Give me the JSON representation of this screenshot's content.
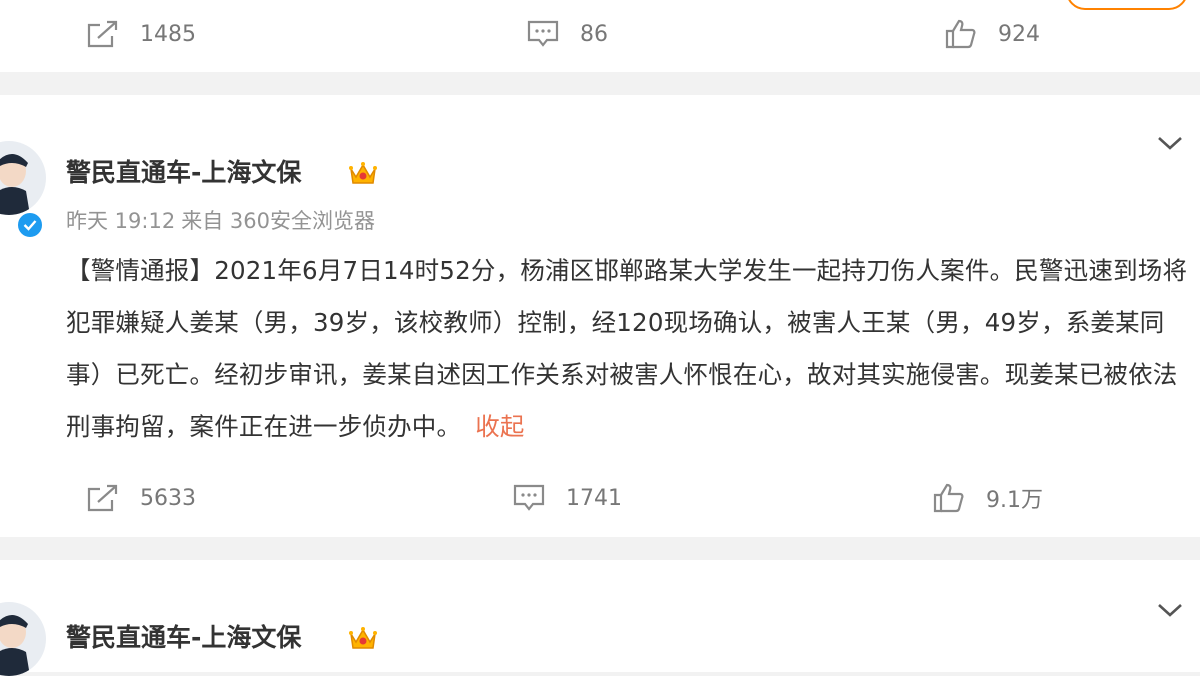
{
  "posts": [
    {
      "actions": {
        "repost_count": "1485",
        "comment_count": "86",
        "like_count": "924"
      }
    },
    {
      "author": "警民直通车-上海文保",
      "time": "昨天 19:12",
      "source": "来自 360安全浏览器",
      "text": "【警情通报】2021年6月7日14时52分，杨浦区邯郸路某大学发生一起持刀伤人案件。民警迅速到场将犯罪嫌疑人姜某（男，39岁，该校教师）控制，经120现场确认，被害人王某（男，49岁，系姜某同事）已死亡。经初步审讯，姜某自述因工作关系对被害人怀恨在心，故对其实施侵害。现姜某已被依法刑事拘留，案件正在进一步侦办中。",
      "collapse_label": "收起",
      "actions": {
        "repost_count": "5633",
        "comment_count": "1741",
        "like_count": "9.1万"
      }
    },
    {
      "author": "警民直通车-上海文保"
    }
  ],
  "colors": {
    "accent": "#ff8200",
    "link": "#eb7350",
    "verified": "#1d9bf0",
    "muted": "#939393",
    "text": "#333333"
  },
  "icons": [
    "repost-icon",
    "comment-icon",
    "like-icon",
    "chevron-down-icon",
    "crown-icon",
    "verified-icon"
  ]
}
